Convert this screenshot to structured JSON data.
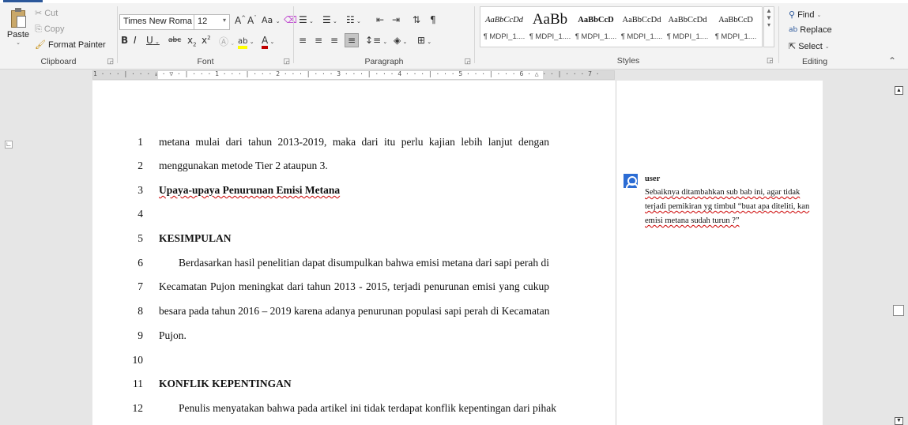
{
  "ribbon": {
    "clipboard": {
      "paste": "Paste",
      "cut": "Cut",
      "copy": "Copy",
      "format_painter": "Format Painter",
      "label": "Clipboard"
    },
    "font": {
      "font_name": "Times New Roma",
      "font_size": "12",
      "change_case": "Aa",
      "label": "Font"
    },
    "paragraph": {
      "label": "Paragraph"
    },
    "styles": {
      "label": "Styles",
      "items": [
        {
          "preview": "AaBbCcDd",
          "name": "¶ MDPI_1...."
        },
        {
          "preview": "AaBb",
          "name": "¶ MDPI_1...."
        },
        {
          "preview": "AaBbCcD",
          "name": "¶ MDPI_1...."
        },
        {
          "preview": "AaBbCcDd",
          "name": "¶ MDPI_1...."
        },
        {
          "preview": "AaBbCcDd",
          "name": "¶ MDPI_1...."
        },
        {
          "preview": "AaBbCcD",
          "name": "¶ MDPI_1...."
        }
      ]
    },
    "editing": {
      "find": "Find",
      "replace": "Replace",
      "select": "Select",
      "label": "Editing"
    }
  },
  "ruler": {
    "ticks": "1 · · · | · · · ↓ · ▽ · | · · · 1 · · · | · · · 2 · · · | · · · 3 · · · | · · · 4 · · · | · · · 5 · · · | · · · 6 · △ · · | · · · 7 ·"
  },
  "document": {
    "lines": [
      {
        "num": "1",
        "text": "metana mulai dari tahun 2013-2019, maka dari itu perlu kajian lebih lanjut dengan"
      },
      {
        "num": "2",
        "text": "menggunakan metode Tier 2 ataupun 3."
      },
      {
        "num": "3",
        "text": "Upaya-upaya Penurunan Emisi Metana"
      },
      {
        "num": "4",
        "text": ""
      },
      {
        "num": "5",
        "text": "KESIMPULAN"
      },
      {
        "num": "6",
        "text": "Berdasarkan hasil penelitian dapat disumpulkan bahwa emisi metana dari sapi perah di"
      },
      {
        "num": "7",
        "text": "Kecamatan Pujon meningkat dari tahun 2013 - 2015, terjadi penurunan emisi yang cukup"
      },
      {
        "num": "8",
        "text": "besara pada tahun 2016 – 2019 karena adanya penurunan populasi sapi perah di Kecamatan"
      },
      {
        "num": "9",
        "text": "Pujon."
      },
      {
        "num": "10",
        "text": ""
      },
      {
        "num": "11",
        "text": "KONFLIK KEPENTINGAN"
      },
      {
        "num": "12",
        "text": "Penulis menyatakan bahwa pada artikel ini tidak terdapat konflik kepentingan dari pihak"
      }
    ]
  },
  "comment": {
    "user": "user",
    "text": "Sebaiknya ditambahkan sub bab ini, agar tidak terjadi pemikiran yg timbul “buat apa diteliti, kan emisi metana sudah turun ?”"
  },
  "colors": {
    "accent": "#2b579a",
    "avatar": "#2b6cd4",
    "spell_squiggle": "#c00000",
    "highlight": "#ffff00",
    "font_color": "#c00000"
  }
}
